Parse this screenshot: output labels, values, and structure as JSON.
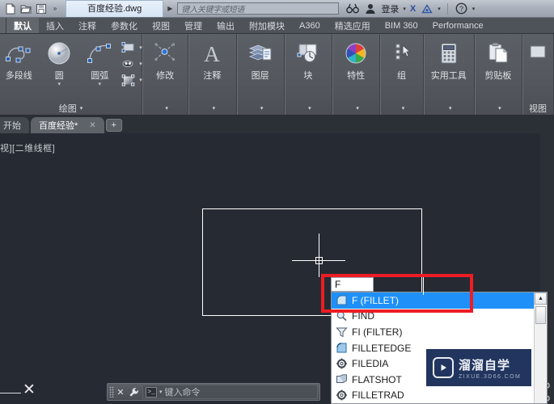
{
  "titlebar": {
    "icons": [
      {
        "name": "new-file-icon",
        "label": "新建"
      },
      {
        "name": "open-folder-icon",
        "label": "打开"
      },
      {
        "name": "save-icon",
        "label": "保存"
      },
      {
        "name": "qat-more-icon",
        "label": "»"
      }
    ],
    "document_name": "百度经验.dwg",
    "doc_caret": "▶",
    "search_placeholder": "键入关键字或短语",
    "search_icon": "binoculars-icon",
    "account_icon": "user-account-icon",
    "signin_label": "登录",
    "signin_caret": "▾",
    "exchange_label": "X",
    "autodesk_label": "A",
    "autodesk_caret": "▾",
    "help_label": "?",
    "help_caret": "▾"
  },
  "ribbon_tabs": [
    {
      "label": "默认",
      "active": true
    },
    {
      "label": "插入",
      "active": false
    },
    {
      "label": "注释",
      "active": false
    },
    {
      "label": "参数化",
      "active": false
    },
    {
      "label": "视图",
      "active": false
    },
    {
      "label": "管理",
      "active": false
    },
    {
      "label": "输出",
      "active": false
    },
    {
      "label": "附加模块",
      "active": false
    },
    {
      "label": "A360",
      "active": false
    },
    {
      "label": "精选应用",
      "active": false
    },
    {
      "label": "BIM 360",
      "active": false
    },
    {
      "label": "Performance",
      "active": false
    }
  ],
  "ribbon_panels": [
    {
      "title": "绘图",
      "title_caret": "▾",
      "buttons": [
        {
          "label": "多段线",
          "icon": "polyline-icon",
          "caret": ""
        },
        {
          "label": "圆",
          "icon": "circle-icon",
          "caret": "▾"
        },
        {
          "label": "圆弧",
          "icon": "arc-icon",
          "caret": "▾"
        }
      ],
      "small_buttons": [
        {
          "icon": "rectangle-icon",
          "caret": "▾"
        },
        {
          "icon": "hatch-pattern-icon",
          "caret": "▾"
        },
        {
          "icon": "gradient-icon",
          "caret": "▾"
        }
      ]
    },
    {
      "title": "",
      "title_caret": "▾",
      "buttons": [
        {
          "label": "修改",
          "icon": "modify-icon",
          "caret": ""
        }
      ],
      "small_buttons": []
    },
    {
      "title": "",
      "title_caret": "▾",
      "buttons": [
        {
          "label": "注释",
          "icon": "annotation-a-icon",
          "caret": ""
        }
      ],
      "small_buttons": []
    },
    {
      "title": "",
      "title_caret": "▾",
      "buttons": [
        {
          "label": "图层",
          "icon": "layers-icon",
          "caret": ""
        }
      ],
      "small_buttons": []
    },
    {
      "title": "",
      "title_caret": "▾",
      "buttons": [
        {
          "label": "块",
          "icon": "block-icon",
          "caret": ""
        }
      ],
      "small_buttons": []
    },
    {
      "title": "",
      "title_caret": "▾",
      "buttons": [
        {
          "label": "特性",
          "icon": "properties-wheel-icon",
          "caret": ""
        }
      ],
      "small_buttons": []
    },
    {
      "title": "",
      "title_caret": "▾",
      "buttons": [
        {
          "label": "组",
          "icon": "group-icon",
          "caret": ""
        }
      ],
      "small_buttons": []
    },
    {
      "title": "",
      "title_caret": "▾",
      "buttons": [
        {
          "label": "实用工具",
          "icon": "calculator-icon",
          "caret": ""
        }
      ],
      "small_buttons": []
    },
    {
      "title": "",
      "title_caret": "▾",
      "buttons": [
        {
          "label": "剪贴板",
          "icon": "clipboard-icon",
          "caret": ""
        }
      ],
      "small_buttons": []
    },
    {
      "title": "视图",
      "title_caret": "",
      "buttons": [
        {
          "label": "",
          "icon": "view-icon",
          "caret": ""
        }
      ],
      "small_buttons": []
    }
  ],
  "doc_tabs": [
    {
      "label": "开始",
      "active": false,
      "closable": false
    },
    {
      "label": "百度经验*",
      "active": true,
      "closable": true,
      "close_glyph": "✕"
    }
  ],
  "doc_tab_add": "+",
  "canvas": {
    "viewport_label": "视][二维线框]",
    "ucs_marker": "✕"
  },
  "command_autocomplete": {
    "typed_text": "F",
    "items": [
      {
        "label": "F (FILLET)",
        "icon": "fillet-icon",
        "selected": true
      },
      {
        "label": "FIND",
        "icon": "find-magnifier-icon",
        "selected": false
      },
      {
        "label": "FI (FILTER)",
        "icon": "filter-funnel-icon",
        "selected": false
      },
      {
        "label": "FILLETEDGE",
        "icon": "filletedge-icon",
        "selected": false
      },
      {
        "label": "FILEDIA",
        "icon": "gear-icon",
        "selected": false
      },
      {
        "label": "FLATSHOT",
        "icon": "flatshot-icon",
        "selected": false
      },
      {
        "label": "FILLETRAD",
        "icon": "gear-icon",
        "selected": false
      }
    ],
    "scroll_up_glyph": "▲"
  },
  "command_bar": {
    "close_glyph": "✕",
    "customize_icon": "wrench-icon",
    "prompt_icon": ">_",
    "prompt_caret": "▾",
    "placeholder": "键入命令"
  },
  "watermark": {
    "logo_icon": "play-button-icon",
    "title": "溜溜自学",
    "subtitle": "ZIXUE.3D66.COM"
  },
  "status_icons": [
    {
      "name": "settings-gear-icon",
      "glyph": "⚙"
    },
    {
      "name": "settings-gear2-icon",
      "glyph": "⚙"
    }
  ],
  "colors": {
    "accent_blue": "#1e90f8",
    "highlight_red": "#ee1c24",
    "canvas_bg": "#262b33",
    "ribbon_bg": "#54585e",
    "watermark_bg": "#21355e"
  }
}
